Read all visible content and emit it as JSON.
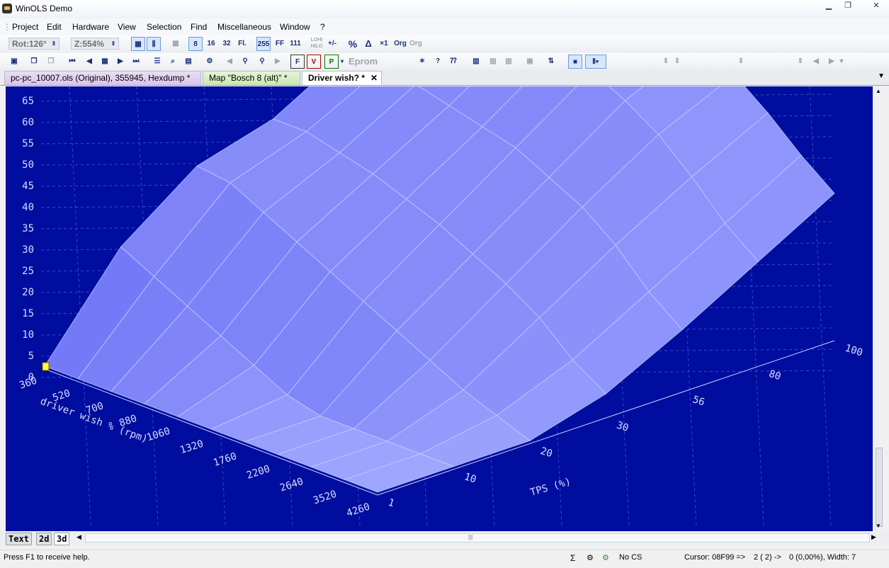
{
  "window": {
    "title": "WinOLS Demo"
  },
  "menu": [
    "Project",
    "Edit",
    "Hardware",
    "View",
    "Selection",
    "Find",
    "Miscellaneous",
    "Window",
    "?"
  ],
  "toolbar1": {
    "rotation": "Rot:126°",
    "zoom": "Z:554%",
    "buttons": [
      "8",
      "16",
      "32",
      "Fl.",
      "255",
      "FF",
      "111",
      "LOHI HILO",
      "+/-",
      "%",
      "Δ",
      "×1",
      "Org",
      "Org"
    ]
  },
  "toolbar2": {
    "eprom_label": "Eprom"
  },
  "tabs": [
    {
      "label": "pc-pc_10007.ols (Original), 355945, Hexdump *"
    },
    {
      "label": "Map \"Bosch  8 (alt)\" *"
    },
    {
      "label": "Driver wish? *"
    }
  ],
  "tab_close": "✕",
  "view_tabs": [
    "Text",
    "2d",
    "3d"
  ],
  "status": {
    "help": "Press F1 to receive help.",
    "checksum": "No CS",
    "cursor": "Cursor: 08F99 =>",
    "position": "2 (  2) ->",
    "value": "0 (0,00%), Width: 7"
  },
  "colors": {
    "background": "#010d9e",
    "surface_light": "#aab2ff",
    "surface_dark": "#4a4ff0",
    "grid": "#c8d0ff",
    "text": "#d8dcff"
  },
  "chart_data": {
    "type": "surface3d",
    "x_axis": {
      "label": "driver wish % (rpm)",
      "ticks": [
        "360",
        "520",
        "700",
        "880",
        "1060",
        "1320",
        "1760",
        "2200",
        "2640",
        "3520",
        "4260"
      ]
    },
    "y_axis": {
      "label": "TPS (%)",
      "ticks": [
        "1",
        "10",
        "20",
        "30",
        "56",
        "80",
        "100"
      ]
    },
    "z_axis": {
      "ticks": [
        "0",
        "5",
        "10",
        "15",
        "20",
        "25",
        "30",
        "35",
        "40",
        "45",
        "50",
        "55",
        "60",
        "65"
      ],
      "range": [
        0,
        65
      ]
    },
    "surface_approx": {
      "rpm": [
        360,
        520,
        700,
        880,
        1060,
        1320,
        1760,
        2200,
        2640,
        3520,
        4260
      ],
      "tps": [
        1,
        10,
        20,
        30,
        56,
        80,
        100
      ],
      "z": [
        [
          0,
          22,
          35,
          40,
          50,
          60,
          67
        ],
        [
          0,
          18,
          34,
          40,
          49,
          59,
          67
        ],
        [
          0,
          14,
          30,
          38,
          48,
          58,
          67
        ],
        [
          0,
          10,
          26,
          36,
          46,
          57,
          66
        ],
        [
          0,
          6,
          22,
          33,
          44,
          56,
          65
        ],
        [
          0,
          2,
          18,
          30,
          42,
          54,
          63
        ],
        [
          0,
          0,
          14,
          26,
          38,
          50,
          58
        ],
        [
          0,
          0,
          10,
          22,
          34,
          45,
          53
        ],
        [
          0,
          0,
          6,
          17,
          28,
          38,
          47
        ],
        [
          0,
          0,
          3,
          10,
          20,
          30,
          40
        ],
        [
          0,
          0,
          0,
          5,
          14,
          24,
          34
        ]
      ]
    }
  }
}
